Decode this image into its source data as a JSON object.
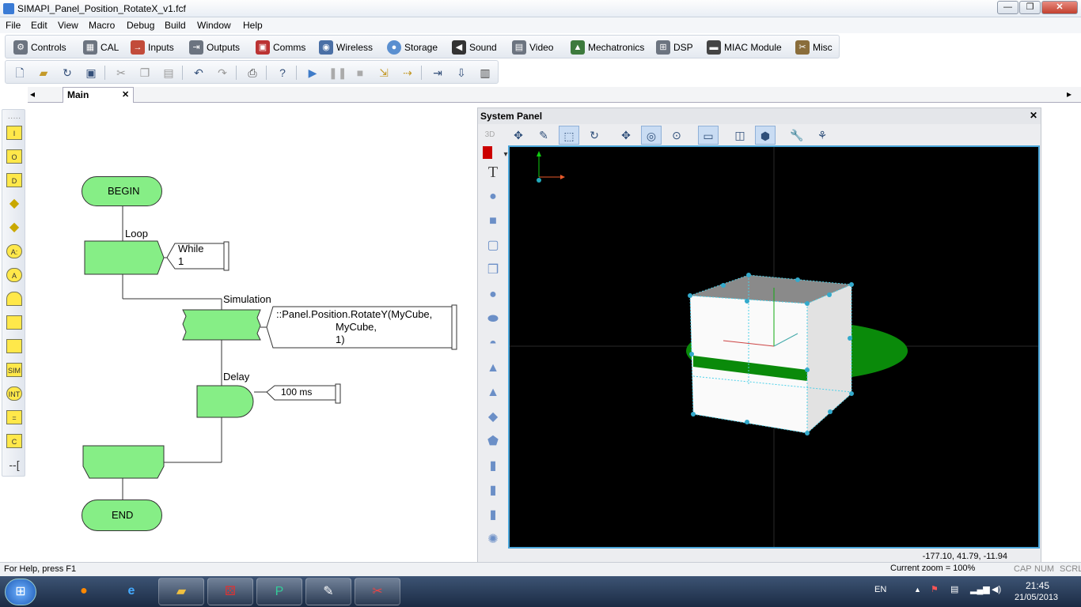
{
  "window": {
    "title": "SIMAPI_Panel_Position_RotateX_v1.fcf",
    "min": "—",
    "max": "❐",
    "close": "✕"
  },
  "menu": [
    "File",
    "Edit",
    "View",
    "Macro",
    "Debug",
    "Build",
    "Window",
    "Help"
  ],
  "components": [
    "Controls",
    "CAL",
    "Inputs",
    "Outputs",
    "Comms",
    "Wireless",
    "Storage",
    "Sound",
    "Video",
    "Mechatronics",
    "DSP",
    "MIAC Module",
    "Misc"
  ],
  "tabs": {
    "left_arrow": "◂",
    "right_arrow": "▸",
    "main": "Main",
    "close": "✕"
  },
  "flowchart": {
    "begin": "BEGIN",
    "loop_label": "Loop",
    "while_line1": "While",
    "while_line2": "1",
    "sim_label": "Simulation",
    "sim_line1": "::Panel.Position.RotateY(MyCube,",
    "sim_line2": "MyCube,",
    "sim_line3": "1)",
    "delay_label": "Delay",
    "delay_value": "100 ms",
    "end": "END"
  },
  "left_icons": [
    "I",
    "O",
    "D",
    "",
    "",
    "A:",
    "A",
    "",
    "",
    "",
    "SIM",
    "INT",
    "=",
    "C",
    ""
  ],
  "system_panel": {
    "title": "System Panel",
    "close": "✕",
    "mode": "3D",
    "text_tool": "T",
    "coords": "-177.10, 41.79, -11.94"
  },
  "status": {
    "help": "For Help, press F1",
    "zoom": "Current zoom = 100%",
    "cap": "CAP",
    "num": "NUM",
    "scrl": "SCRL"
  },
  "tray": {
    "lang": "EN",
    "time": "21:45",
    "date": "21/05/2013"
  },
  "colors": {
    "flow_fill": "#86ee86",
    "viewport": "#000000",
    "ring": "#0a8a0a"
  }
}
